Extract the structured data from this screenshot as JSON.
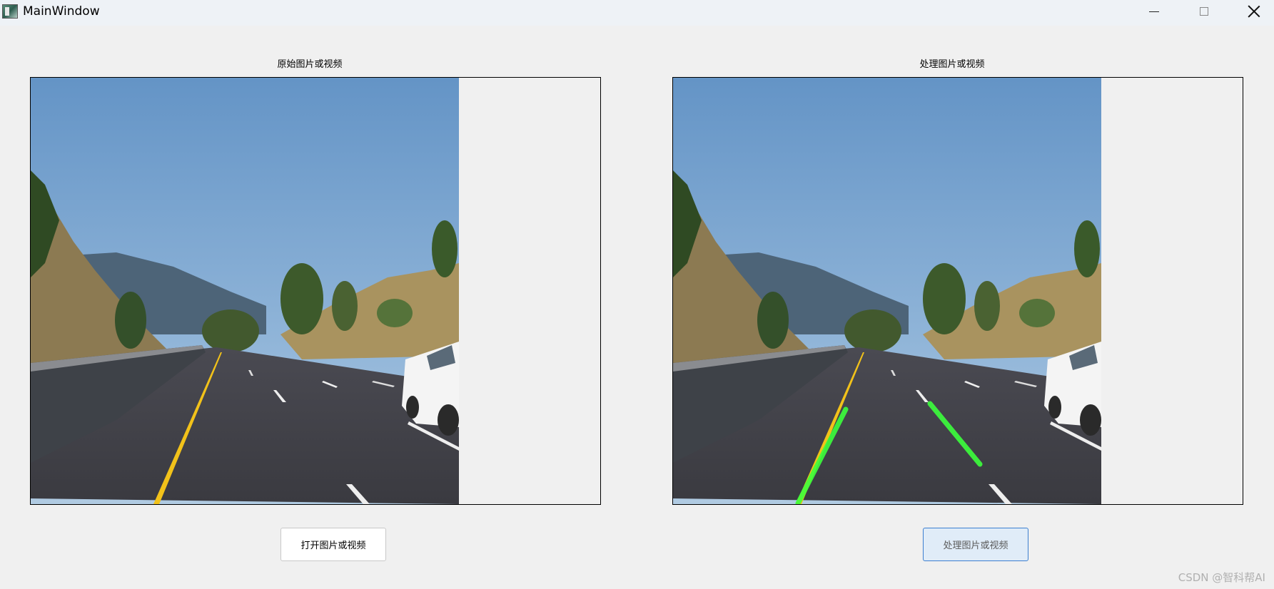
{
  "window": {
    "title": "MainWindow"
  },
  "panels": {
    "left_label": "原始图片或视频",
    "right_label": "处理图片或视频"
  },
  "buttons": {
    "open_label": "打开图片或视频",
    "process_label": "处理图片或视频"
  },
  "watermark": "CSDN @智科帮AI",
  "colors": {
    "background": "#f0f0f0",
    "titlebar": "#eef2f6",
    "process_button_bg": "#e0ecf8",
    "process_button_border": "#3c7fd0",
    "detected_lane": "#3cff3c",
    "yellow_lane": "#f2c21a"
  }
}
